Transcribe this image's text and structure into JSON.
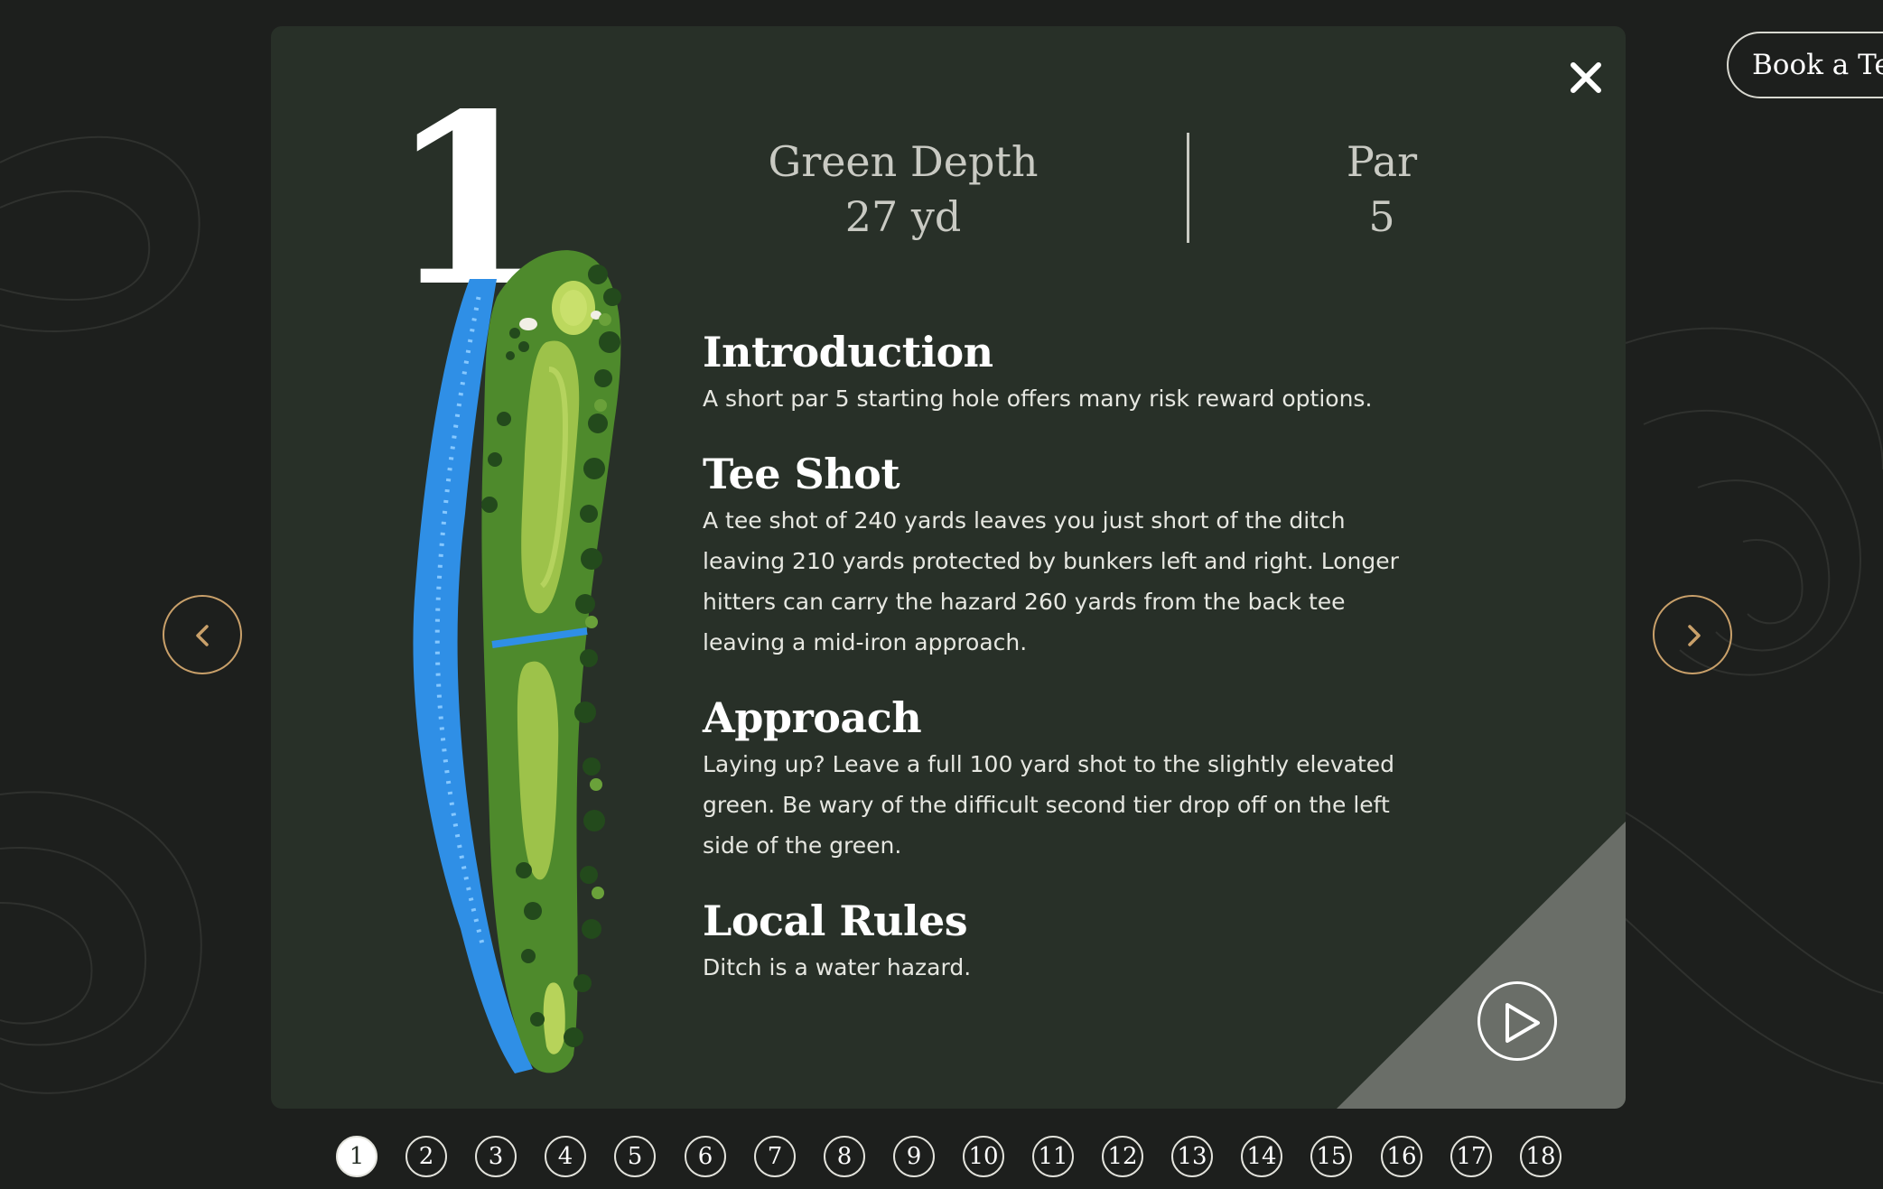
{
  "header": {
    "book_label": "Book a Tee"
  },
  "hole": {
    "number": "1",
    "green_depth_label": "Green Depth",
    "green_depth_value": "27 yd",
    "par_label": "Par",
    "par_value": "5"
  },
  "sections": [
    {
      "title": "Introduction",
      "text": "A short par 5 starting hole offers many risk reward options."
    },
    {
      "title": "Tee Shot",
      "text": "A tee shot of 240 yards leaves you just short of the ditch leaving 210 yards protected by bunkers left and right. Longer hitters can carry the hazard 260 yards from the back tee leaving a mid-iron approach."
    },
    {
      "title": "Approach",
      "text": "Laying up? Leave a full 100 yard shot to the slightly elevated green. Be wary of the difficult second tier drop off on the left side of the green."
    },
    {
      "title": "Local Rules",
      "text": "Ditch is a water hazard."
    }
  ],
  "icons": {
    "close": "close-icon",
    "play": "play-icon",
    "prev": "chevron-left-icon",
    "next": "chevron-right-icon"
  },
  "colors": {
    "background": "#1d1f1d",
    "modal": "#283028",
    "accent": "#c9a06a",
    "corner": "#6a6e68"
  },
  "pager": {
    "active": "1",
    "items": [
      "1",
      "2",
      "3",
      "4",
      "5",
      "6",
      "7",
      "8",
      "9",
      "10",
      "11",
      "12",
      "13",
      "14",
      "15",
      "16",
      "17",
      "18"
    ]
  }
}
